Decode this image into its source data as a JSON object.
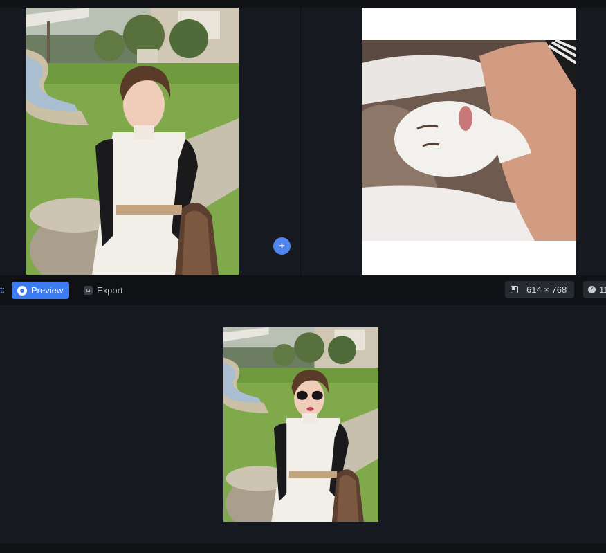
{
  "toolbar": {
    "prefix_label": "t:",
    "preview_label": "Preview",
    "export_label": "Export",
    "dimensions": "614 × 768",
    "timing": "11"
  },
  "add_button": {
    "label": "+"
  },
  "icons": {
    "preview": "eye-icon",
    "export": "export-icon",
    "dimensions": "resize-icon",
    "timing": "clock-icon"
  },
  "colors": {
    "accent": "#3b7cf2",
    "background": "#16191f",
    "toolbar": "#0f1115"
  }
}
